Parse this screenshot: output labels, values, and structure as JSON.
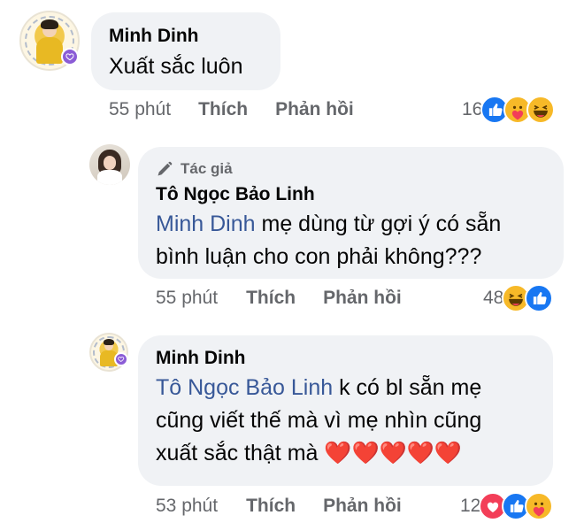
{
  "comments": [
    {
      "author": "Minh Dinh",
      "text": "Xuất sắc luôn",
      "time": "55 phút",
      "like_label": "Thích",
      "reply_label": "Phản hồi",
      "reaction_count": "16",
      "reactions": [
        "like-icon",
        "care-icon",
        "haha-icon"
      ]
    },
    {
      "author_badge": "Tác giả",
      "author": "Tô Ngọc Bảo Linh",
      "mention": "Minh Dinh",
      "text_line1": " mẹ dùng từ gợi ý có sẵn",
      "text_line2": "bình luận cho con phải không???",
      "time": "55 phút",
      "like_label": "Thích",
      "reply_label": "Phản hồi",
      "reaction_count": "48",
      "reactions": [
        "haha-icon",
        "like-icon"
      ]
    },
    {
      "author": "Minh Dinh",
      "mention": "Tô Ngọc Bảo Linh",
      "text_line1": " k có bl sẵn mẹ",
      "text_line2": "cũng viết thế mà vì mẹ nhìn  cũng",
      "text_line3": "xuất sắc thật mà ❤️❤️❤️❤️❤️",
      "time": "53 phút",
      "like_label": "Thích",
      "reply_label": "Phản hồi",
      "reaction_count": "12",
      "reactions": [
        "love-icon",
        "like-icon",
        "care-icon"
      ]
    }
  ],
  "colors": {
    "bubble": "#f0f2f5",
    "mention": "#385898",
    "meta": "#65676b",
    "like_blue": "#1877f2",
    "love_red": "#f33e58",
    "haha_yellow": "#f7b928"
  }
}
